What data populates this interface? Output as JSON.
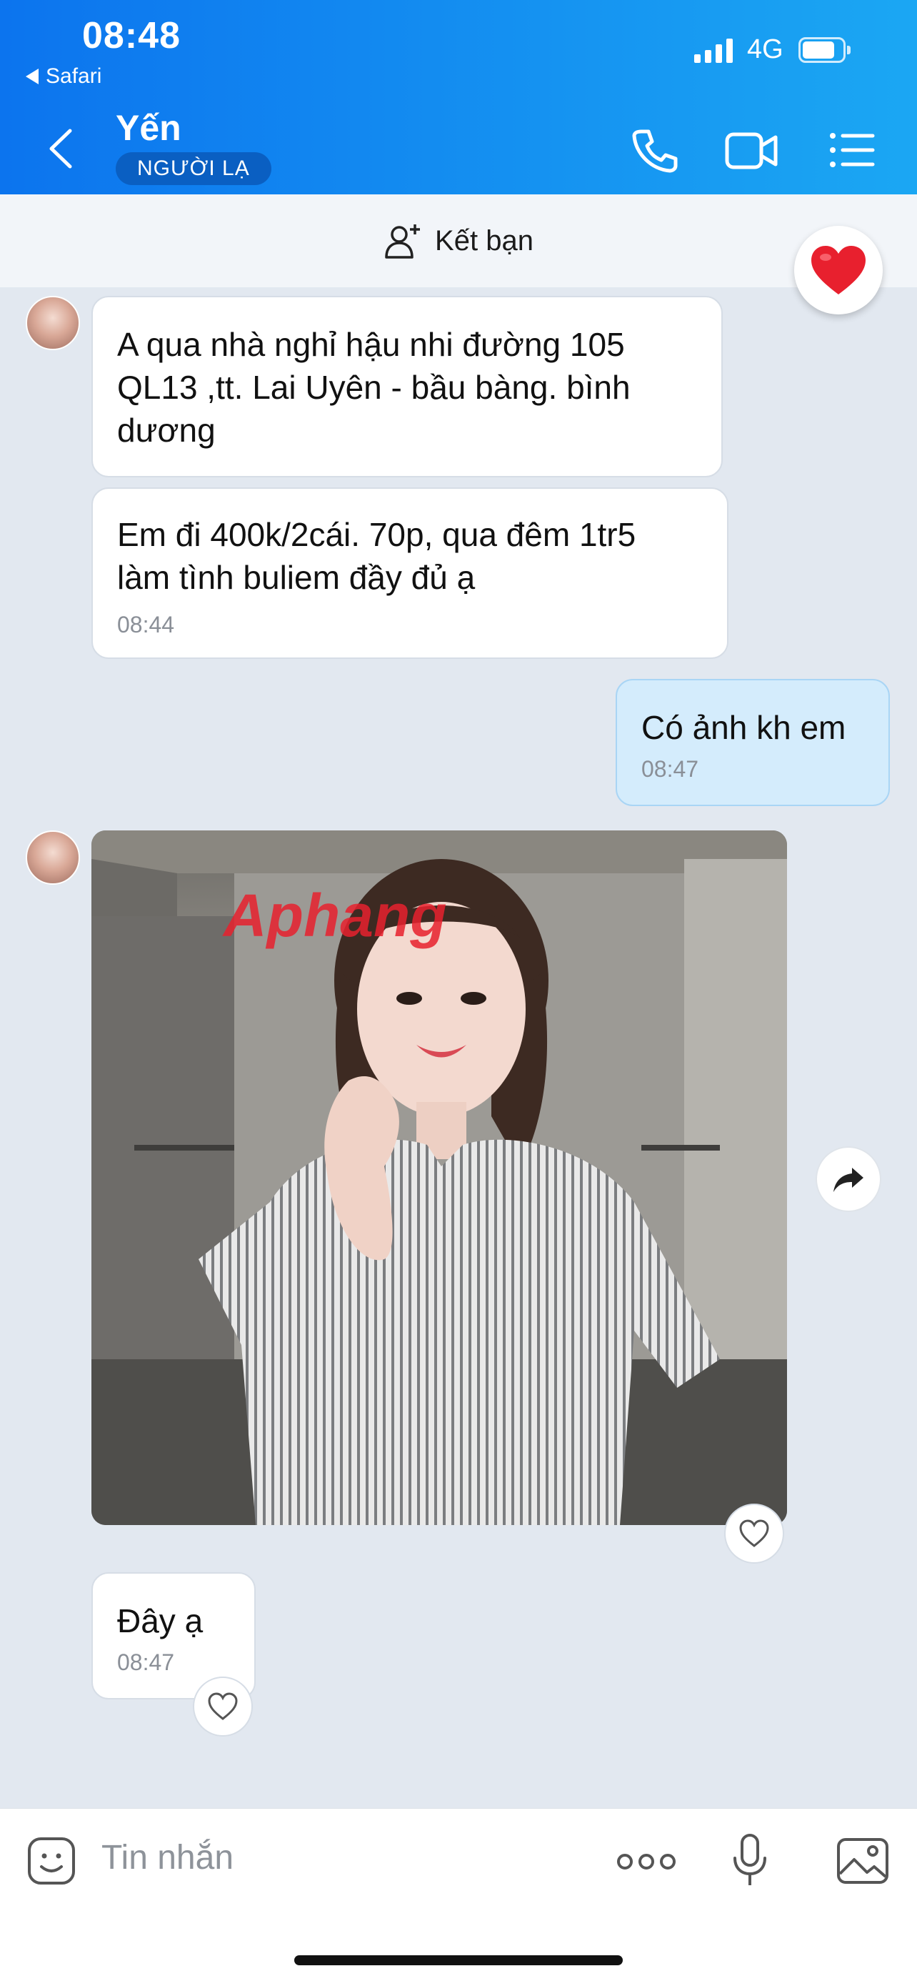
{
  "status_bar": {
    "time": "08:48",
    "back_app": "Safari",
    "network": "4G"
  },
  "header": {
    "name": "Yến",
    "tag": "NGƯỜI LẠ"
  },
  "friend_bar": {
    "label": "Kết bạn"
  },
  "messages": [
    {
      "text": "A qua nhà nghỉ hậu nhi đường 105 QL13 ,tt. Lai Uyên - bầu bàng.  bình dương"
    },
    {
      "text_line1": "Em đi 400k/2cái. 70p, qua đêm 1tr5",
      "text_line2": "làm tình buliem đầy đủ ạ",
      "time": "08:44"
    },
    {
      "text": "Có ảnh kh em",
      "time": "08:47"
    },
    {
      "watermark": "Aphang"
    },
    {
      "text": "Đây ạ",
      "time": "08:47"
    }
  ],
  "composer": {
    "placeholder": "Tin nhắn"
  },
  "colors": {
    "header_start": "#0c74ee",
    "header_end": "#1ba7f3",
    "my_bubble": "#d4ecfc",
    "heart": "#e8202e"
  }
}
